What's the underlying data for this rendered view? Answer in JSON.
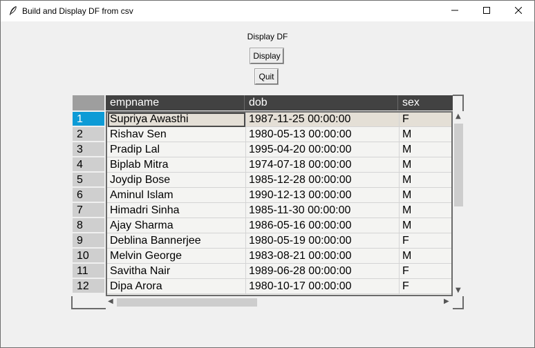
{
  "window": {
    "title": "Build and Display DF from csv"
  },
  "main": {
    "label": "Display DF",
    "display_button": "Display",
    "quit_button": "Quit"
  },
  "table": {
    "columns": [
      "empname",
      "dob",
      "sex"
    ],
    "rows": [
      {
        "idx": "1",
        "empname": "Supriya Awasthi",
        "dob": "1987-11-25 00:00:00",
        "sex": "F"
      },
      {
        "idx": "2",
        "empname": "Rishav Sen",
        "dob": "1980-05-13 00:00:00",
        "sex": "M"
      },
      {
        "idx": "3",
        "empname": "Pradip Lal",
        "dob": "1995-04-20 00:00:00",
        "sex": "M"
      },
      {
        "idx": "4",
        "empname": "Biplab Mitra",
        "dob": "1974-07-18 00:00:00",
        "sex": "M"
      },
      {
        "idx": "5",
        "empname": "Joydip Bose",
        "dob": "1985-12-28 00:00:00",
        "sex": "M"
      },
      {
        "idx": "6",
        "empname": "Aminul Islam",
        "dob": "1990-12-13 00:00:00",
        "sex": "M"
      },
      {
        "idx": "7",
        "empname": "Himadri Sinha",
        "dob": "1985-11-30 00:00:00",
        "sex": "M"
      },
      {
        "idx": "8",
        "empname": "Ajay Sharma",
        "dob": "1986-05-16 00:00:00",
        "sex": "M"
      },
      {
        "idx": "9",
        "empname": "Deblina Bannerjee",
        "dob": "1980-05-19 00:00:00",
        "sex": "F"
      },
      {
        "idx": "10",
        "empname": "Melvin George",
        "dob": "1983-08-21 00:00:00",
        "sex": "M"
      },
      {
        "idx": "11",
        "empname": "Savitha Nair",
        "dob": "1989-06-28 00:00:00",
        "sex": "F"
      },
      {
        "idx": "12",
        "empname": "Dipa Arora",
        "dob": "1980-10-17 00:00:00",
        "sex": "F"
      }
    ],
    "selected_row_index": 0,
    "colors": {
      "header_bg": "#424242",
      "selected_index_bg": "#0d9bd6",
      "selected_row_bg": "#e4dfd6"
    }
  },
  "icons": {
    "app": "feather-icon",
    "minimize": "minimize-icon",
    "maximize": "maximize-icon",
    "close": "close-icon"
  }
}
